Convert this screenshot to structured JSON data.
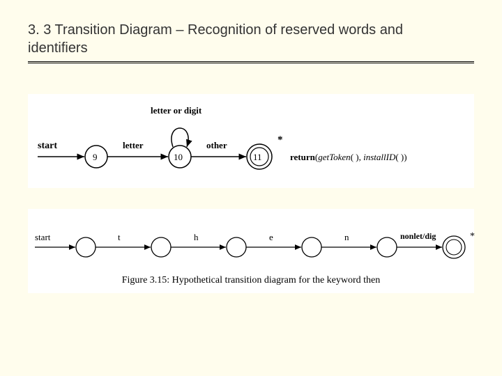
{
  "title_line1": "3. 3 Transition Diagram – Recognition of reserved words and",
  "title_line2": "identifiers",
  "fig1": {
    "start": "start",
    "e_start_9": "",
    "n9": "9",
    "e_9_10": "letter",
    "loop10": "letter or digit",
    "n10": "10",
    "e_10_11": "other",
    "n11": "11",
    "star": "*",
    "ret_a": "return",
    "ret_b": "(",
    "ret_c": "getToken",
    "ret_d": "( ),   ",
    "ret_e": "installID",
    "ret_f": "( ))"
  },
  "fig2": {
    "start": "start",
    "e1": "t",
    "e2": "h",
    "e3": "e",
    "e4": "n",
    "e5": "nonlet/dig",
    "star": "*",
    "caption": "Figure 3.15: Hypothetical transition diagram for the keyword then"
  }
}
